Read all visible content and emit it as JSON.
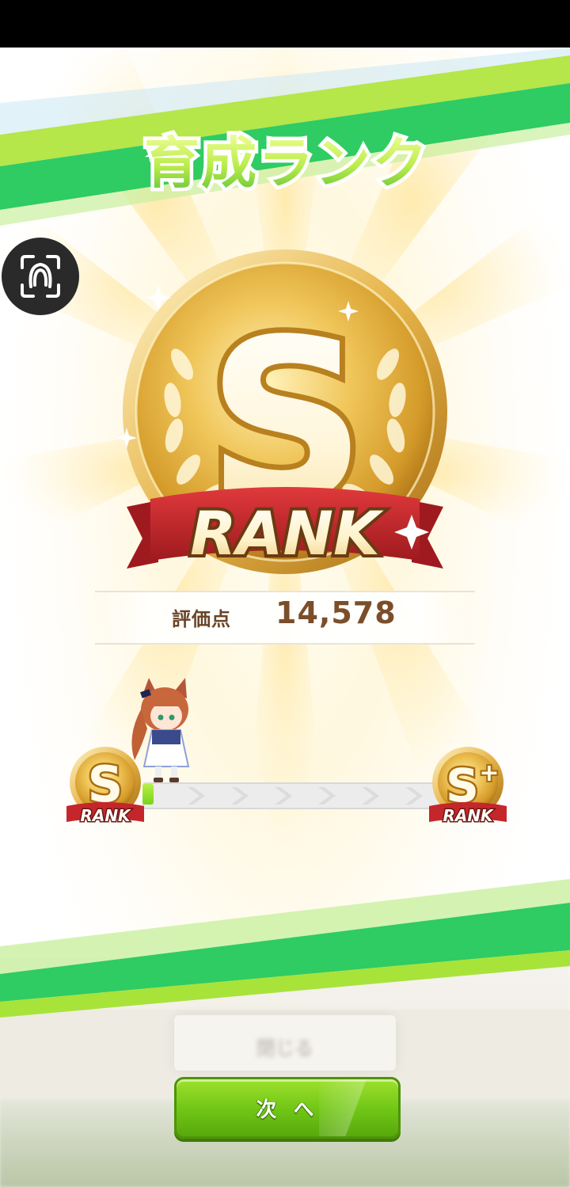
{
  "header": {
    "title": "育成ランク"
  },
  "rank": {
    "letter": "S",
    "label": "RANK"
  },
  "score": {
    "label": "評価点",
    "value": "14,578"
  },
  "progress": {
    "current_rank_letter": "S",
    "current_rank_label": "RANK",
    "next_rank_letter": "S",
    "next_rank_plus": "+",
    "next_rank_label": "RANK",
    "fraction": 0.03
  },
  "background_card": {
    "label": "閉じる"
  },
  "footer": {
    "next_button_label": "次 へ"
  },
  "icons": {
    "camera": "camera-scan-icon",
    "sparkle": "sparkle-icon"
  },
  "colors": {
    "stripe_green": "#2fcb63",
    "stripe_lime": "#a8e33a",
    "gold": "#e5b94a",
    "ribbon_red": "#c4262b",
    "score_brown": "#7b4e2a",
    "button_green": "#6fc515"
  }
}
